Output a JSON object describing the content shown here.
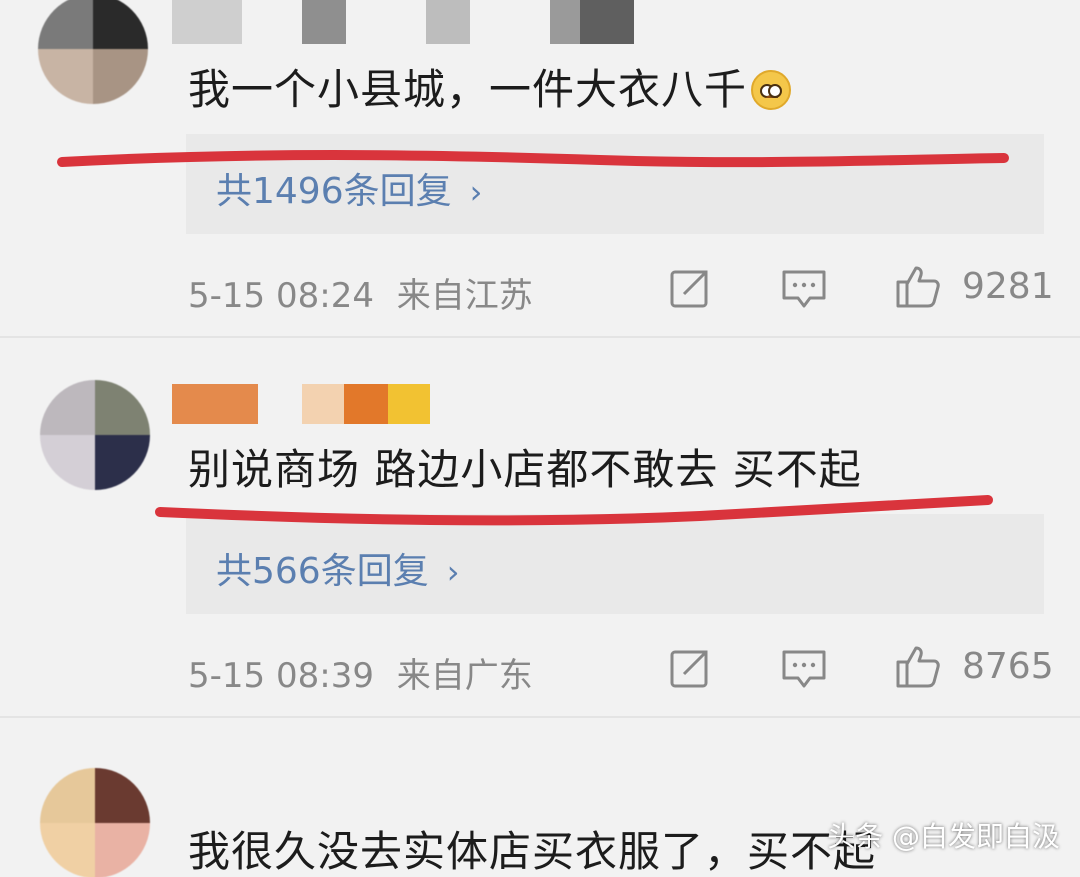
{
  "comments": [
    {
      "text": "我一个小县城，一件大衣八千",
      "emoji": "pleading-face-emoji",
      "reply_link": "共1496条回复",
      "timestamp": "5-15 08:24",
      "location": "来自江苏",
      "likes": "9281"
    },
    {
      "text": "别说商场 路边小店都不敢去 买不起",
      "reply_link": "共566条回复",
      "timestamp": "5-15 08:39",
      "location": "来自广东",
      "likes": "8765"
    },
    {
      "text": "我很久没去实体店买衣服了，买不起"
    }
  ],
  "watermark": "头条 @白发即白汲",
  "colors": {
    "background": "#f2f2f2",
    "reply_box": "#e9e9e9",
    "link_blue": "#5b7fb0",
    "meta_gray": "#888888",
    "underline_red": "#d9343c"
  }
}
